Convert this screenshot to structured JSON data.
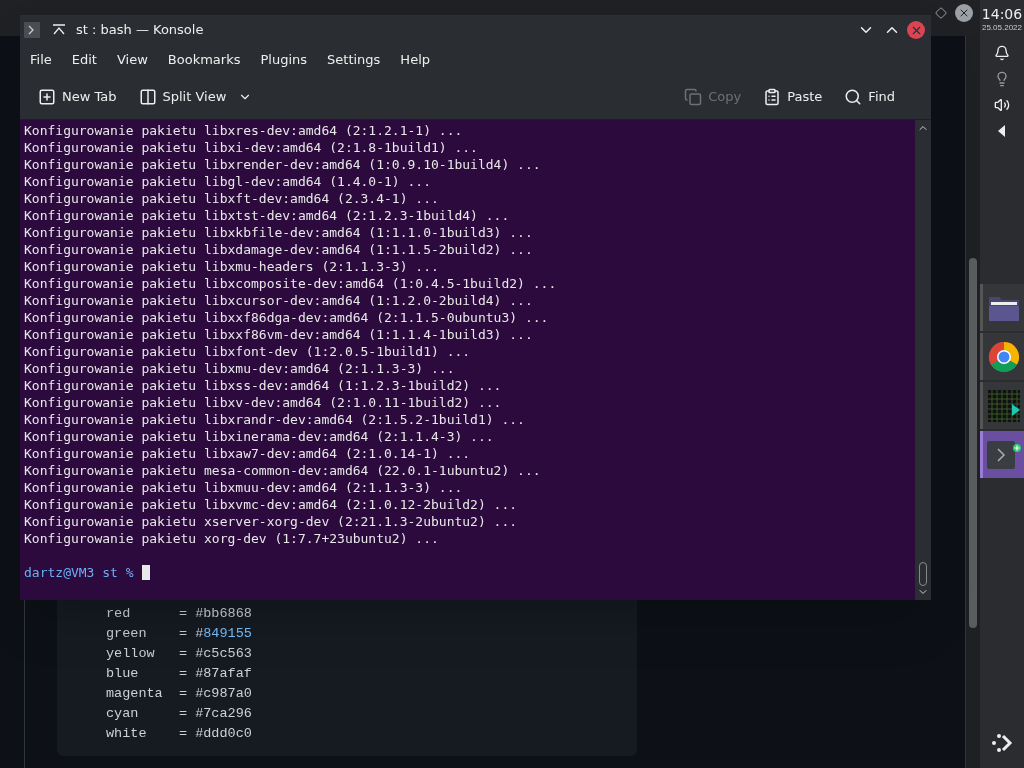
{
  "browser": {
    "code_lines": [
      {
        "name": "red",
        "sep": "=",
        "hash": "#",
        "value": "bb6868",
        "highlighted": false
      },
      {
        "name": "green",
        "sep": "=",
        "hash": "#",
        "value": "849155",
        "highlighted": true
      },
      {
        "name": "yellow",
        "sep": "=",
        "hash": "#",
        "value": "c5c563",
        "highlighted": false
      },
      {
        "name": "blue",
        "sep": "=",
        "hash": "#",
        "value": "87afaf",
        "highlighted": false
      },
      {
        "name": "magenta",
        "sep": "=",
        "hash": "#",
        "value": "c987a0",
        "highlighted": false
      },
      {
        "name": "cyan",
        "sep": "=",
        "hash": "#",
        "value": "7ca296",
        "highlighted": false
      },
      {
        "name": "white",
        "sep": "=",
        "hash": "#",
        "value": "ddd0c0",
        "highlighted": false
      }
    ]
  },
  "konsole": {
    "title": "st : bash — Konsole",
    "menu": [
      "File",
      "Edit",
      "View",
      "Bookmarks",
      "Plugins",
      "Settings",
      "Help"
    ],
    "toolbar": [
      {
        "kind": "new-tab",
        "label": "New Tab",
        "disabled": false
      },
      {
        "kind": "split-view",
        "label": "Split View",
        "disabled": false
      },
      {
        "kind": "copy",
        "label": "Copy",
        "disabled": true
      },
      {
        "kind": "paste",
        "label": "Paste",
        "disabled": false
      },
      {
        "kind": "find",
        "label": "Find",
        "disabled": false
      }
    ],
    "lines": [
      "Konfigurowanie pakietu libxres-dev:amd64 (2:1.2.1-1) ...",
      "Konfigurowanie pakietu libxi-dev:amd64 (2:1.8-1build1) ...",
      "Konfigurowanie pakietu libxrender-dev:amd64 (1:0.9.10-1build4) ...",
      "Konfigurowanie pakietu libgl-dev:amd64 (1.4.0-1) ...",
      "Konfigurowanie pakietu libxft-dev:amd64 (2.3.4-1) ...",
      "Konfigurowanie pakietu libxtst-dev:amd64 (2:1.2.3-1build4) ...",
      "Konfigurowanie pakietu libxkbfile-dev:amd64 (1:1.1.0-1build3) ...",
      "Konfigurowanie pakietu libxdamage-dev:amd64 (1:1.1.5-2build2) ...",
      "Konfigurowanie pakietu libxmu-headers (2:1.1.3-3) ...",
      "Konfigurowanie pakietu libxcomposite-dev:amd64 (1:0.4.5-1build2) ...",
      "Konfigurowanie pakietu libxcursor-dev:amd64 (1:1.2.0-2build4) ...",
      "Konfigurowanie pakietu libxxf86dga-dev:amd64 (2:1.1.5-0ubuntu3) ...",
      "Konfigurowanie pakietu libxxf86vm-dev:amd64 (1:1.1.4-1build3) ...",
      "Konfigurowanie pakietu libxfont-dev (1:2.0.5-1build1) ...",
      "Konfigurowanie pakietu libxmu-dev:amd64 (2:1.1.3-3) ...",
      "Konfigurowanie pakietu libxss-dev:amd64 (1:1.2.3-1build2) ...",
      "Konfigurowanie pakietu libxv-dev:amd64 (2:1.0.11-1build2) ...",
      "Konfigurowanie pakietu libxrandr-dev:amd64 (2:1.5.2-1build1) ...",
      "Konfigurowanie pakietu libxinerama-dev:amd64 (2:1.1.4-3) ...",
      "Konfigurowanie pakietu libxaw7-dev:amd64 (2:1.0.14-1) ...",
      "Konfigurowanie pakietu mesa-common-dev:amd64 (22.0.1-1ubuntu2) ...",
      "Konfigurowanie pakietu libxmuu-dev:amd64 (2:1.1.3-3) ...",
      "Konfigurowanie pakietu libxvmc-dev:amd64 (2:1.0.12-2build2) ...",
      "Konfigurowanie pakietu xserver-xorg-dev (2:21.1.3-2ubuntu2) ...",
      "Konfigurowanie pakietu xorg-dev (1:7.7+23ubuntu2) ..."
    ],
    "prompt": "dartz@VM3 st %"
  },
  "panel": {
    "time": "14:06",
    "date": "25.05.2022",
    "tasks": [
      {
        "kind": "files",
        "selected": false
      },
      {
        "kind": "web",
        "selected": false
      },
      {
        "kind": "monitor",
        "selected": false
      },
      {
        "kind": "terminal",
        "selected": true
      }
    ]
  }
}
